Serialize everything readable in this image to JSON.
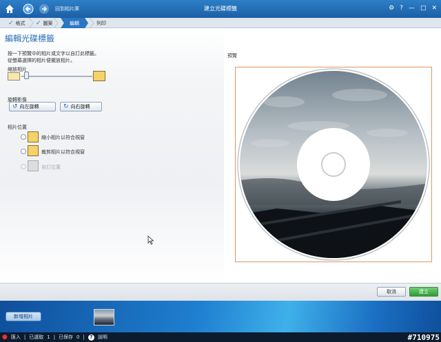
{
  "titlebar": {
    "back_label": "回到相片庫",
    "title": "建立光碟標籤",
    "gear": "⚙",
    "help": "?",
    "minimize": "—",
    "restore": "□",
    "close": "✕"
  },
  "tabs": [
    {
      "label": "格式",
      "done": true
    },
    {
      "label": "圖案",
      "done": true
    },
    {
      "label": "編輯",
      "active": true
    },
    {
      "label": "列印",
      "done": false
    }
  ],
  "page": {
    "title": "編輯光碟標籤",
    "instruction_line1": "按一下預覽中的相片或文字以自訂此標籤。",
    "instruction_line2": "從螢幕選擇的相片便擺放相片。",
    "zoom_label": "縮放相片",
    "zoom_level": 0.05,
    "rotate_label": "旋轉影像",
    "rotate_left": "向左旋轉",
    "rotate_right": "向右旋轉",
    "position_label": "相片位置",
    "options": [
      {
        "label": "縮小相片以符合視窗",
        "enabled": true
      },
      {
        "label": "裁剪相片以符合視窗",
        "enabled": true
      },
      {
        "label": "自訂位置",
        "enabled": false
      }
    ]
  },
  "preview": {
    "label": "預覽"
  },
  "actions": {
    "cancel": "取消",
    "create": "建立"
  },
  "tray": {
    "add_photo": "新增相片"
  },
  "status": {
    "import": "匯入",
    "selected": "已選取",
    "selected_count": "1",
    "saved": "已保存",
    "saved_count": "0",
    "help": "說明"
  },
  "watermark": "#710975",
  "colors": {
    "accent": "#2a76c3",
    "create_button": "#2f9a38",
    "preview_border": "#e59360"
  }
}
